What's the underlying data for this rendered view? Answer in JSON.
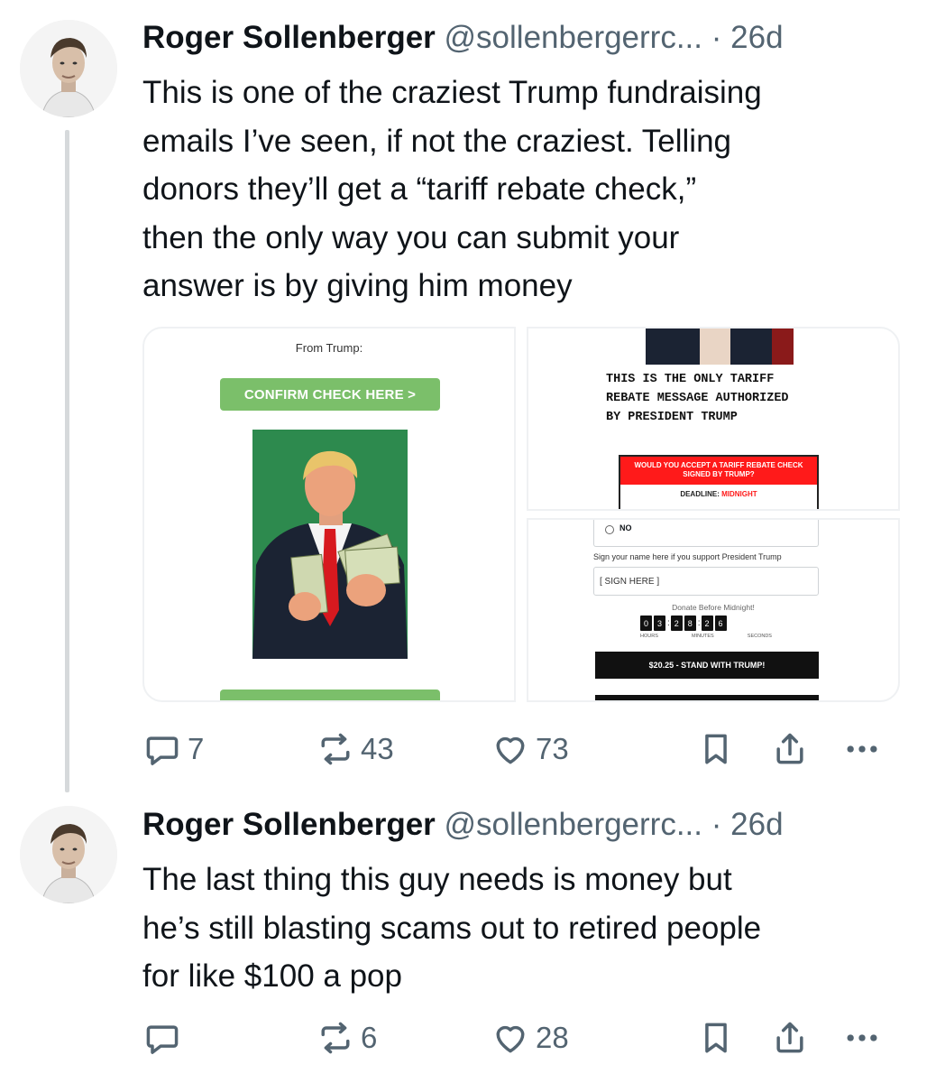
{
  "tweets": [
    {
      "name": "Roger Sollenberger",
      "handle": "@sollenbergerrc...",
      "dot": "·",
      "time": "26d",
      "lines": [
        "This is one of the craziest Trump fundraising",
        "emails I’ve seen, if not the craziest. Telling",
        "donors they’ll get a “tariff rebate check,”",
        "then the only way you can submit your",
        "answer is by giving him money"
      ],
      "replies": "7",
      "reposts": "43",
      "likes": "73"
    },
    {
      "name": "Roger Sollenberger",
      "handle": "@sollenbergerrc...",
      "dot": "·",
      "time": "26d",
      "lines": [
        "The last thing this guy needs is money but",
        "he’s still blasting scams out to retired people",
        "for like $100 a pop"
      ],
      "replies": "",
      "reposts": "6",
      "likes": "28"
    }
  ],
  "email": {
    "from": "From Trump:",
    "confirm_btn": "CONFIRM CHECK HERE >",
    "headline": "THIS IS THE ONLY TARIFF\nREBATE MESSAGE AUTHORIZED\nBY PRESIDENT TRUMP",
    "question": "WOULD YOU ACCEPT A TARIFF REBATE CHECK SIGNED BY TRUMP?",
    "deadline_label": "DEADLINE:",
    "deadline_value": "MIDNIGHT",
    "no_option": "NO",
    "sign_prompt": "Sign your name here if you support President Trump",
    "sign_placeholder": "[ SIGN HERE ]",
    "donate_before": "Donate Before Midnight!",
    "hours": [
      "0",
      "3"
    ],
    "minutes": [
      "2",
      "8"
    ],
    "seconds": [
      "2",
      "6"
    ],
    "hours_label": "HOURS",
    "minutes_label": "MINUTES",
    "seconds_label": "SECONDS",
    "donate_btn": "$20.25 - STAND WITH TRUMP!"
  },
  "colors": {
    "text": "#0f1419",
    "muted": "#536471",
    "thread_line": "#d6d9db",
    "confirm_green": "#7bbf6a",
    "photo_green": "#2d8a4e",
    "alert_red": "#ff1a1a"
  },
  "icons": [
    "reply-icon",
    "repost-icon",
    "like-icon",
    "bookmark-icon",
    "share-icon",
    "more-icon"
  ]
}
